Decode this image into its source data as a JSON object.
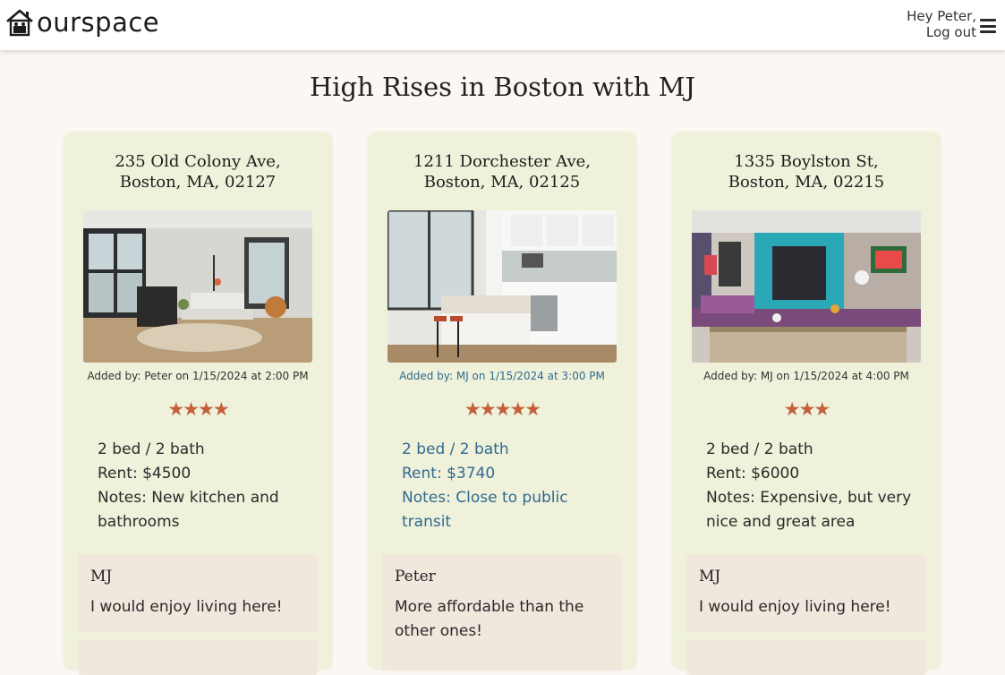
{
  "header": {
    "brand": "ourspace",
    "greeting": "Hey Peter,",
    "logout": "Log out"
  },
  "page": {
    "title": "High Rises in Boston with MJ"
  },
  "listings": [
    {
      "address_line1": "235 Old Colony Ave,",
      "address_line2": "Boston, MA, 02127",
      "added_by": "Added by: Peter on 1/15/2024 at 2:00 PM",
      "rating": 4,
      "stars": "★★★★",
      "beds_baths": "2 bed / 2 bath",
      "rent": "Rent: $4500",
      "notes": "Notes: New kitchen and bathrooms",
      "comment": {
        "author": "MJ",
        "text": "I would enjoy living here!"
      }
    },
    {
      "address_line1": "1211 Dorchester Ave,",
      "address_line2": "Boston, MA, 02125",
      "added_by": "Added by: MJ on 1/15/2024 at 3:00 PM",
      "rating": 5,
      "stars": "★★★★★",
      "beds_baths": "2 bed / 2 bath",
      "rent": "Rent: $3740",
      "notes": "Notes: Close to public transit",
      "comment": {
        "author": "Peter",
        "text": "More affordable than the other ones!"
      }
    },
    {
      "address_line1": "1335 Boylston St,",
      "address_line2": "Boston, MA, 02215",
      "added_by": "Added by: MJ on 1/15/2024 at 4:00 PM",
      "rating": 3,
      "stars": "★★★",
      "beds_baths": "2 bed / 2 bath",
      "rent": "Rent: $6000",
      "notes": "Notes: Expensive, but very nice and great area",
      "comment": {
        "author": "MJ",
        "text": "I would enjoy living here!"
      }
    }
  ],
  "colors": {
    "star": "#c45f3c",
    "card_bg": "#eff1da",
    "comment_bg": "#f0e7dd",
    "highlight_text": "#2e6a91"
  }
}
